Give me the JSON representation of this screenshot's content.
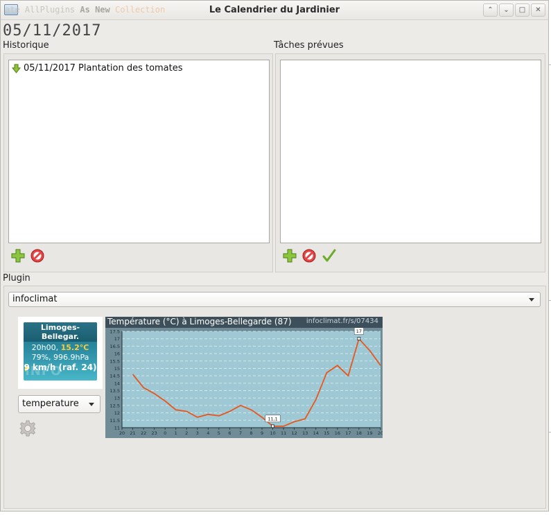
{
  "window": {
    "title": "Le Calendrier du Jardinier",
    "behind_text": {
      "part1": "ate AllPlugins",
      "part2": "As New",
      "part3": "Collection"
    },
    "buttons": [
      "⌃",
      "⌄",
      "□",
      "✕"
    ]
  },
  "date": "05/11/2017",
  "historique": {
    "label": "Historique",
    "items": [
      {
        "text": "05/11/2017 Plantation des tomates",
        "icon": "down-arrow-icon"
      }
    ]
  },
  "taches": {
    "label": "Tâches prévues",
    "items": []
  },
  "plugin": {
    "label": "Plugin",
    "selected": "infoclimat",
    "weather": {
      "station": "Limoges-Bellegar.",
      "time": "20h00,",
      "temperature": "15.2°C",
      "humidity_pressure": "79%, 996.9hPa",
      "wind": "9 km/h (raf. 24)",
      "watermark": "INFO CLIMAT"
    },
    "variable": "temperature"
  },
  "chart_data": {
    "type": "line",
    "title": "Température (°C) à Limoges-Bellegarde (87)",
    "source": "infoclimat.fr/s/07434",
    "x": [
      "20",
      "21",
      "22",
      "23",
      "0",
      "1",
      "2",
      "3",
      "4",
      "5",
      "6",
      "7",
      "8",
      "9",
      "10",
      "11",
      "12",
      "13",
      "14",
      "15",
      "16",
      "17",
      "18",
      "19",
      "20"
    ],
    "y_ticks": [
      "11",
      "11.5",
      "12",
      "12.5",
      "13",
      "13.5",
      "14",
      "14.5",
      "15",
      "15.5",
      "16",
      "16.5",
      "17",
      "17.5"
    ],
    "ylim": [
      11,
      17.5
    ],
    "series": [
      {
        "values": [
          null,
          14.6,
          13.7,
          13.3,
          12.8,
          12.2,
          12.1,
          11.7,
          11.9,
          11.8,
          12.1,
          12.5,
          12.2,
          11.7,
          11.1,
          11.1,
          11.4,
          11.6,
          12.9,
          14.7,
          15.2,
          14.5,
          17.0,
          16.2,
          15.2
        ],
        "color": "#e8561c"
      }
    ],
    "annotations": [
      {
        "x": "10",
        "label": "11,1"
      },
      {
        "x": "18",
        "label": "17"
      }
    ],
    "grid": true
  }
}
